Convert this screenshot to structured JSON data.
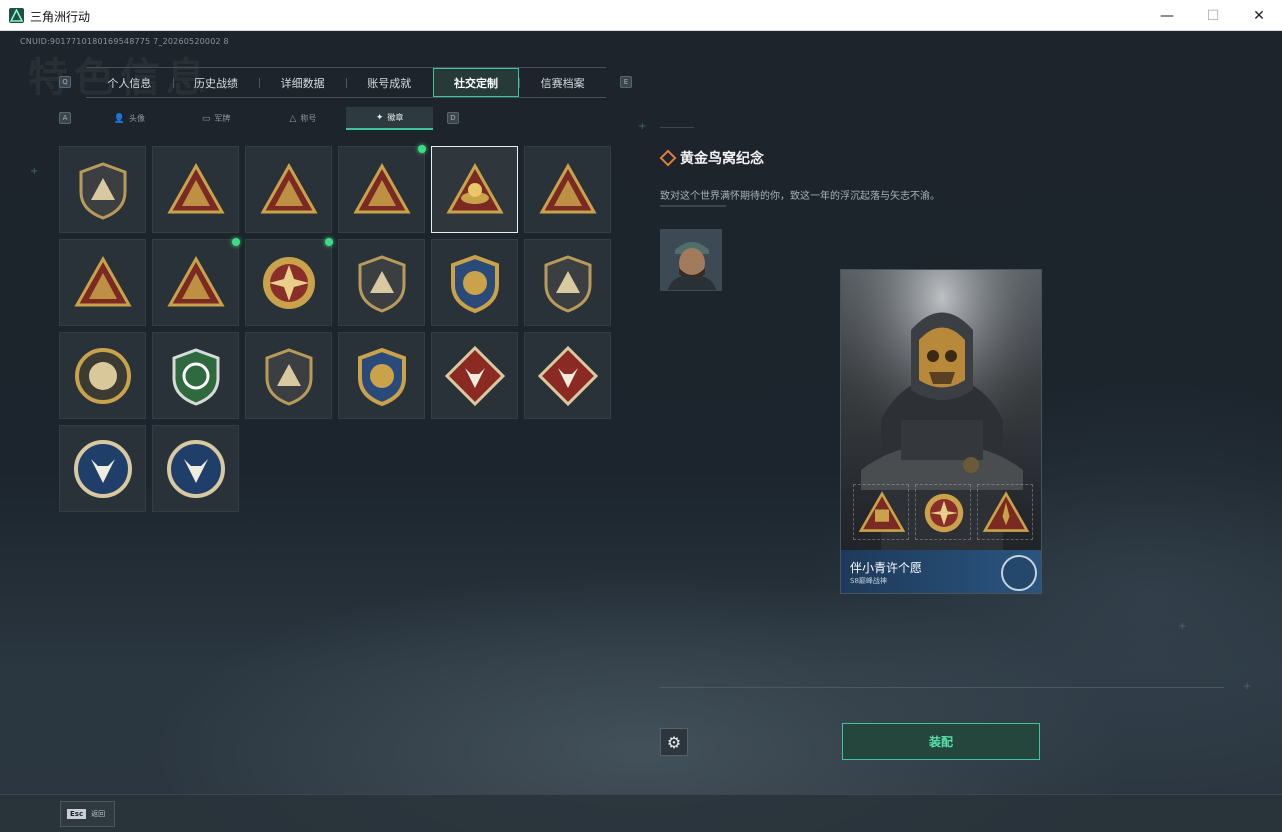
{
  "window": {
    "title": "三角洲行动",
    "min": "—",
    "max": "☐",
    "close": "✕"
  },
  "uid": "CNUID:9017710180169548775 7_20260520002 8",
  "watermark": "特色信息",
  "keys": {
    "tab_left": "Q",
    "tab_right": "E",
    "sub_left": "A",
    "sub_right": "D"
  },
  "tabs": [
    {
      "label": "个人信息",
      "active": false
    },
    {
      "label": "历史战绩",
      "active": false
    },
    {
      "label": "详细数据",
      "active": false
    },
    {
      "label": "账号成就",
      "active": false
    },
    {
      "label": "社交定制",
      "active": true
    },
    {
      "label": "信赛档案",
      "active": false
    }
  ],
  "subtabs": [
    {
      "label": "头像",
      "icon": "person-icon",
      "active": false
    },
    {
      "label": "军牌",
      "icon": "dogtag-icon",
      "active": false
    },
    {
      "label": "称号",
      "icon": "title-icon",
      "active": false
    },
    {
      "label": "徽章",
      "icon": "emblem-icon",
      "active": true
    }
  ],
  "badges": [
    {
      "icon": "shield-triangle-badge",
      "new": false,
      "selected": false
    },
    {
      "icon": "helicopter-badge",
      "new": false,
      "selected": false
    },
    {
      "icon": "s4-triangle-badge",
      "new": false,
      "selected": false
    },
    {
      "icon": "s8-triangle-badge",
      "new": true,
      "selected": false
    },
    {
      "icon": "golden-nest-badge",
      "new": false,
      "selected": true
    },
    {
      "icon": "number-one-triangle-badge",
      "new": false,
      "selected": false
    },
    {
      "icon": "soldiers-triangle-badge",
      "new": false,
      "selected": false
    },
    {
      "icon": "rocket-triangle-badge",
      "new": true,
      "selected": false
    },
    {
      "icon": "star-compass-badge",
      "new": true,
      "selected": false
    },
    {
      "icon": "shield-eagle-badge",
      "new": false,
      "selected": false
    },
    {
      "icon": "starred-shield-badge",
      "new": false,
      "selected": false
    },
    {
      "icon": "diamond-shield-badge",
      "new": false,
      "selected": false
    },
    {
      "icon": "pearl-shell-badge",
      "new": false,
      "selected": false
    },
    {
      "icon": "green-crosshair-badge",
      "new": false,
      "selected": false
    },
    {
      "icon": "rifle-shield-badge",
      "new": false,
      "selected": false
    },
    {
      "icon": "blue-gold-crest-badge",
      "new": false,
      "selected": false
    },
    {
      "icon": "wolf-diamond-badge",
      "new": false,
      "selected": false
    },
    {
      "icon": "wolf-diamond-badge-2",
      "new": false,
      "selected": false
    },
    {
      "icon": "wolf-circle-badge",
      "new": false,
      "selected": false
    },
    {
      "icon": "wolf-circle-badge-2",
      "new": false,
      "selected": false
    }
  ],
  "detail": {
    "title": "黄金鸟窝纪念",
    "description": "致对这个世界满怀期待的你，致这一年的浮沉起落与矢志不渝。"
  },
  "card": {
    "name": "伴小青许个愿",
    "subtitle": "S8巅峰战神"
  },
  "actions": {
    "equip": "装配",
    "settings_icon": "⚙"
  },
  "bottom": {
    "esc_key": "Esc",
    "esc_label": "返回"
  },
  "colors": {
    "accent": "#3fc49a",
    "new_dot": "#3ddc84",
    "gold": "#c9a24a",
    "triangle_red": "#7a2a22"
  }
}
